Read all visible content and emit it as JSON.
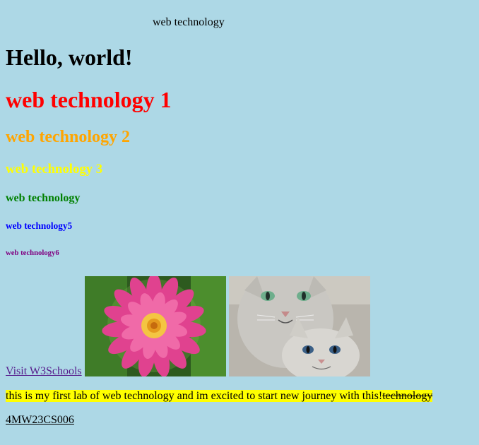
{
  "marquee": "web technology",
  "headings": {
    "h1": "Hello, world!",
    "h2": "web technology 1",
    "h3": "web technology 2",
    "h4": "web technology 3",
    "h5": "web technology",
    "h6": "web technology5",
    "h7": "web technology6"
  },
  "link": {
    "label": "Visit W3Schools"
  },
  "images": {
    "flower_icon": "flower-image",
    "cats_icon": "cats-image"
  },
  "highlight": {
    "main": "this is my first lab of web technology and im excited to start new journey with this!",
    "strike": "technology"
  },
  "usn": "4MW23CS006",
  "colors": {
    "background": "#add8e6",
    "h2": "red",
    "h3": "orange",
    "h4": "yellow",
    "h5": "green",
    "h6": "blue",
    "h7": "purple",
    "mark": "yellow"
  }
}
